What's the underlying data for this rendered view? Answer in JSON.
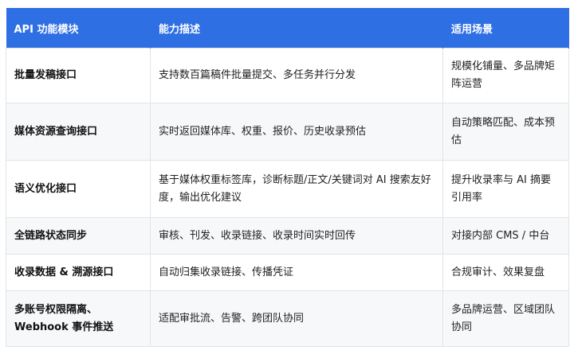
{
  "table": {
    "headers": [
      "API 功能模块",
      "能力描述",
      "适用场景"
    ],
    "rows": [
      {
        "name": "批量发稿接口",
        "desc": "支持数百篇稿件批量提交、多任务并行分发",
        "scene": "规模化铺量、多品牌矩阵运营"
      },
      {
        "name": "媒体资源查询接口",
        "desc": "实时返回媒体库、权重、报价、历史收录预估",
        "scene": "自动策略匹配、成本预估"
      },
      {
        "name": "语义优化接口",
        "desc": "基于媒体权重标签库，诊断标题/正文/关键词对 AI 搜索友好度，输出优化建议",
        "scene": "提升收录率与 AI 摘要引用率"
      },
      {
        "name": "全链路状态同步",
        "desc": "审核、刊发、收录链接、收录时间实时回传",
        "scene": "对接内部 CMS / 中台"
      },
      {
        "name": "收录数据 & 溯源接口",
        "desc": "自动归集收录链接、传播凭证",
        "scene": "合规审计、效果复盘"
      },
      {
        "name": "多账号权限隔离、Webhook 事件推送",
        "desc": "适配审批流、告警、跨团队协同",
        "scene": "多品牌运营、区域团队协同"
      }
    ]
  }
}
